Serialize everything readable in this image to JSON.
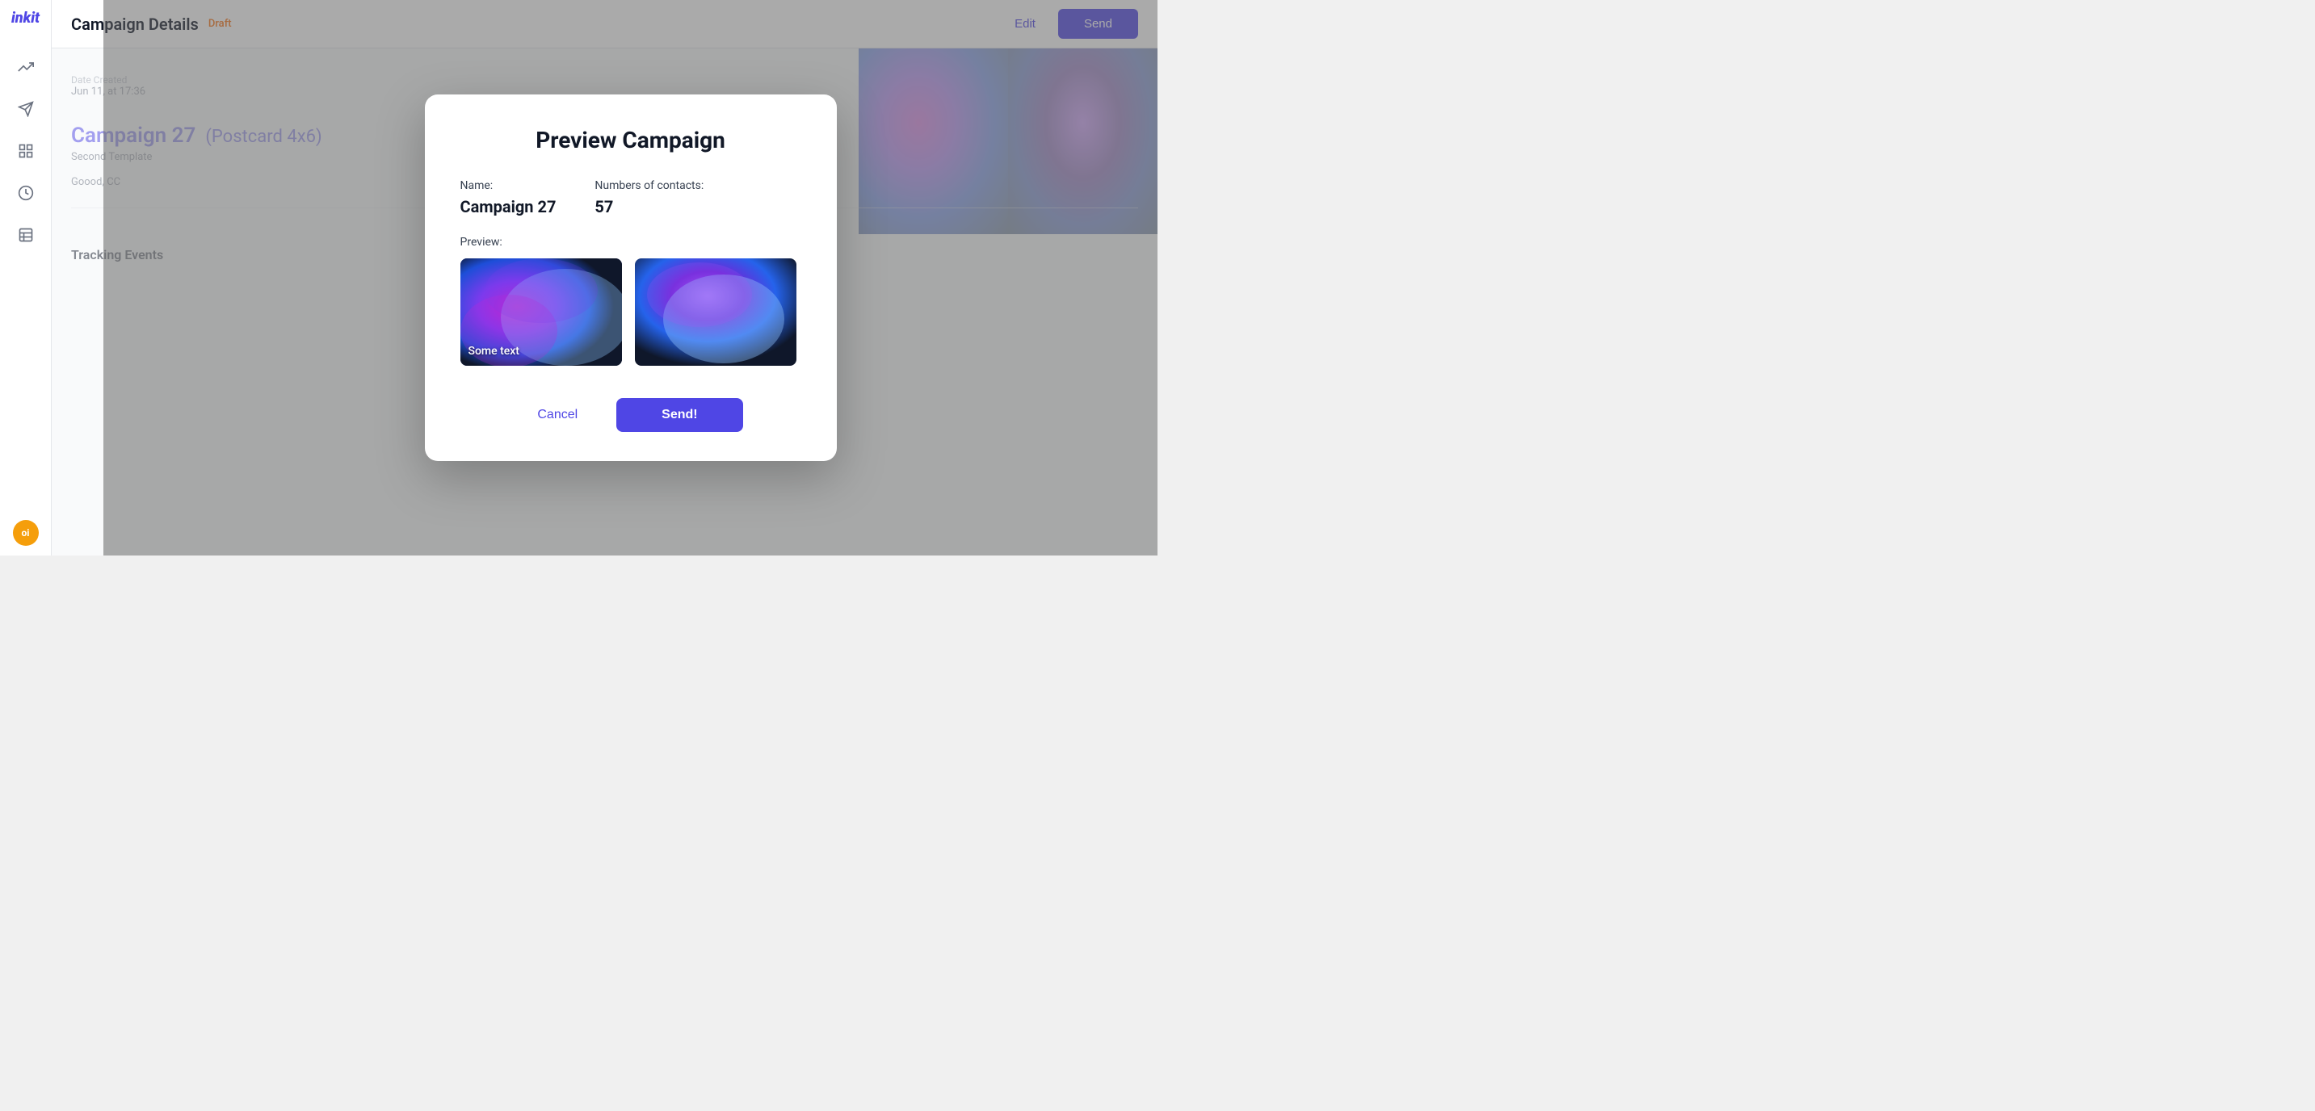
{
  "app": {
    "logo": "inkit"
  },
  "sidebar": {
    "icons": [
      {
        "name": "chart-icon",
        "symbol": "📈"
      },
      {
        "name": "send-icon",
        "symbol": "✉"
      },
      {
        "name": "grid-icon",
        "symbol": "⊞"
      },
      {
        "name": "clock-icon",
        "symbol": "◷"
      },
      {
        "name": "list-icon",
        "symbol": "☰"
      }
    ],
    "avatar_initials": "oi"
  },
  "header": {
    "title": "Campaign Details",
    "badge": "Draft",
    "edit_label": "Edit",
    "send_label": "Send"
  },
  "campaign": {
    "date_label": "Date Created",
    "date_value": "Jun 11, at 17:36",
    "name": "Campaign 27",
    "type": "(Postcard 4x6)",
    "template": "Second Template",
    "location": "Goood, CC",
    "tracking_title": "Tracking Events"
  },
  "modal": {
    "title": "Preview Campaign",
    "name_label": "Name:",
    "name_value": "Campaign 27",
    "contacts_label": "Numbers of contacts:",
    "contacts_value": "57",
    "preview_label": "Preview:",
    "preview_text": "Some text",
    "cancel_label": "Cancel",
    "send_label": "Send!"
  }
}
